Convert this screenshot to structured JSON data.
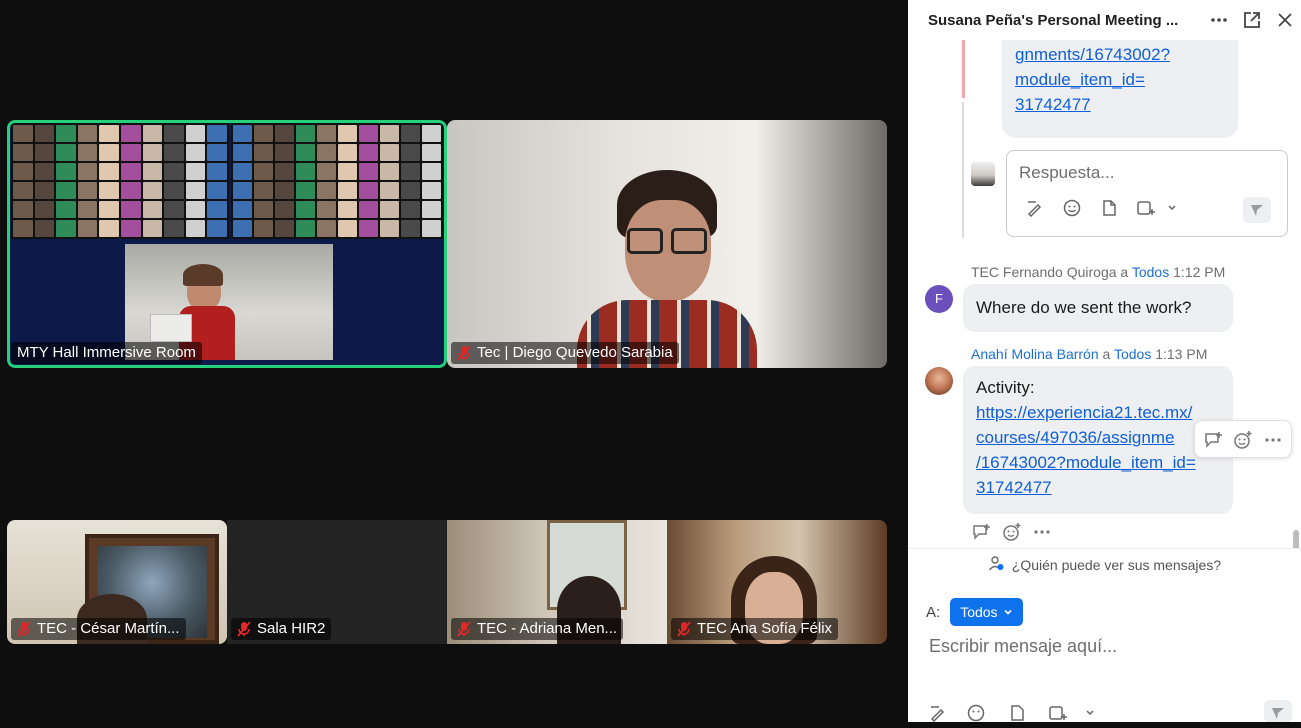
{
  "chat_panel": {
    "title": "Susana Peña's Personal Meeting ...",
    "thread_link_lines": [
      "gnments/16743002?",
      "module_item_id=",
      "31742477"
    ],
    "reply_placeholder": "Respuesta...",
    "messages": [
      {
        "sender": "TEC Fernando Quiroga",
        "to_word": "a",
        "recipient": "Todos",
        "time": "1:12 PM",
        "avatar_letter": "F",
        "text": "Where do we sent the work?"
      },
      {
        "sender": "Anahí Molina Barrón",
        "to_word": "a",
        "recipient": "Todos",
        "time": "1:13 PM",
        "text": "Activity:",
        "link_lines": [
          "https://experiencia21.tec.mx/",
          "courses/497036/assignme",
          "/16743002?module_item_id=",
          "31742477"
        ]
      }
    ],
    "who_can_see": "¿Quién puede ver sus mensajes?",
    "to_label": "A:",
    "to_value": "Todos",
    "compose_placeholder": "Escribir mensaje aquí..."
  },
  "video_tiles": [
    {
      "name": "MTY Hall Immersive Room",
      "muted": false
    },
    {
      "name": "Tec | Diego Quevedo Sarabia",
      "muted": true
    },
    {
      "name": "TEC - César Martín...",
      "muted": true
    },
    {
      "name": "Sala HIR2",
      "muted": true
    },
    {
      "name": "TEC - Adriana Men...",
      "muted": true
    },
    {
      "name": "TEC Ana Sofía Félix",
      "muted": true
    }
  ],
  "colors": {
    "accent": "#0e72ed",
    "active_speaker": "#27d07a",
    "mute_red": "#e02828",
    "avatar_f": "#6b4fbb"
  },
  "icons": {
    "more": "more-icon",
    "pop_out": "pop-out-icon",
    "close": "close-icon",
    "mic_off": "mic-off-icon"
  }
}
